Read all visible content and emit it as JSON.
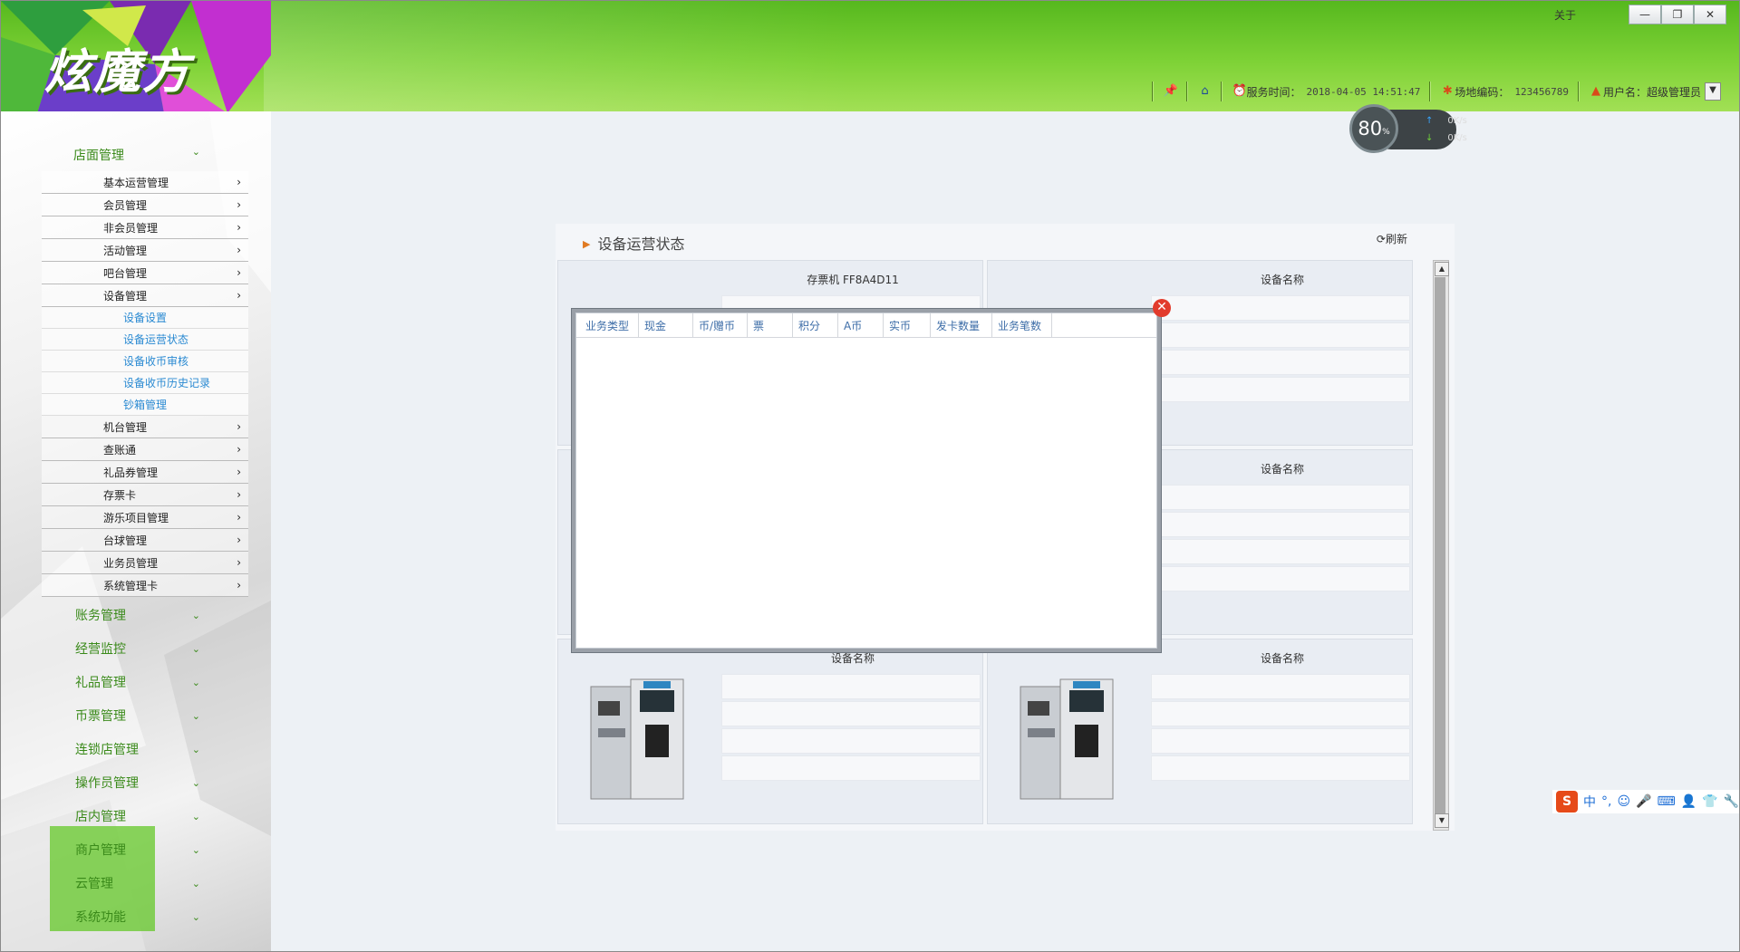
{
  "app": {
    "logo_text": "炫魔方",
    "about_label": "关于",
    "window_buttons": [
      "—",
      "❐",
      "✕"
    ]
  },
  "status": {
    "service_time_label": "服务时间：",
    "service_time_value": "2018-04-05 14:51:47",
    "site_code_label": "场地编码：",
    "site_code_value": "123456789",
    "user_label": "用户名：",
    "user_value": "超级管理员"
  },
  "gauge": {
    "percent": "80",
    "percent_unit": "%",
    "upload": "0K/s",
    "download": "0K/s"
  },
  "sidebar": {
    "top_group": "店面管理",
    "sub_items": [
      "基本运营管理",
      "会员管理",
      "非会员管理",
      "活动管理",
      "吧台管理",
      "设备管理"
    ],
    "device_leaves": [
      "设备设置",
      "设备运营状态",
      "设备收币审核",
      "设备收币历史记录",
      "钞箱管理"
    ],
    "sub_items_after": [
      "机台管理",
      "查账通",
      "礼品券管理",
      "存票卡",
      "游乐项目管理",
      "台球管理",
      "业务员管理",
      "系统管理卡"
    ],
    "main_groups": [
      "账务管理",
      "经营监控",
      "礼品管理",
      "币票管理",
      "连锁店管理",
      "操作员管理",
      "店内管理",
      "商户管理",
      "云管理",
      "系统功能"
    ]
  },
  "panel": {
    "title": "设备运营状态",
    "refresh_label": "刷新",
    "cards": [
      {
        "name": "存票机 FF8A4D11"
      },
      {
        "name": "设备名称"
      },
      {
        "name": ""
      },
      {
        "name": "设备名称"
      },
      {
        "name": "设备名称"
      },
      {
        "name": "设备名称"
      }
    ]
  },
  "dialog": {
    "columns": [
      "业务类型",
      "现金",
      "币/赠币",
      "票",
      "积分",
      "A币",
      "实币",
      "发卡数量",
      "业务笔数"
    ],
    "close_label": "✕"
  },
  "ime": {
    "logo": "S",
    "mode": "中"
  },
  "colors": {
    "header_green": "#7ed236",
    "nav_green": "#3a8a1a",
    "link_blue": "#2a8ad2",
    "close_red": "#e23b2c"
  }
}
